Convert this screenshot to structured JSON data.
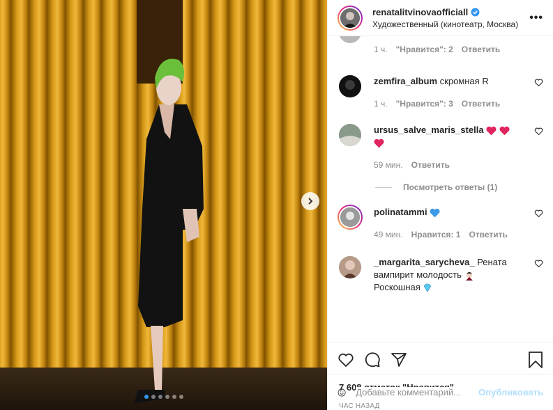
{
  "post": {
    "username": "renatalitvinova​officiall",
    "location": "Художественный (кинотеатр, Москва)",
    "more_icon": "more-horizontal-icon",
    "verified_icon": "verified-badge-icon"
  },
  "media": {
    "next_icon": "chevron-right-icon",
    "slides_count": 6,
    "active_slide": 1
  },
  "comments": [
    {
      "user": "",
      "text": "",
      "time": "1 ч.",
      "likes": "\"Нравится\": 2",
      "reply": "Ответить"
    },
    {
      "user": "zemfira_album",
      "text": "скромная R",
      "time": "1 ч.",
      "likes": "\"Нравится\": 3",
      "reply": "Ответить"
    },
    {
      "user": "ursus_salve_maris_stella",
      "text": "",
      "emoji": "red-heart-emoji ×3",
      "time": "59 мин.",
      "likes": "",
      "reply": "Ответить",
      "view_replies": "Посмотреть ответы (1)"
    },
    {
      "user": "polinatammi",
      "text": "",
      "emoji": "blue-heart-emoji",
      "time": "49 мин.",
      "likes": "Нравится: 1",
      "reply": "Ответить"
    },
    {
      "user": "_margarita_sarycheva_",
      "text_line1": "Рената",
      "text_line2": "вампирит молодость",
      "text_line3": "Роскошная",
      "emoji1": "vampire-emoji",
      "emoji2": "gem-emoji"
    }
  ],
  "actions": {
    "like_icon": "heart-icon",
    "comment_icon": "comment-icon",
    "share_icon": "share-icon",
    "save_icon": "bookmark-icon"
  },
  "likes_text": "7 608 отметок \"Нравится\"",
  "time_ago": "час назад",
  "add_comment": {
    "placeholder": "Добавьте комментарий...",
    "publish_label": "Опубликовать",
    "emoji_icon": "smiley-icon"
  },
  "colors": {
    "accent": "#3897f0",
    "curtain": "#c98a12",
    "red_heart": "#e0245e",
    "blue_heart": "#3d9ae8"
  }
}
